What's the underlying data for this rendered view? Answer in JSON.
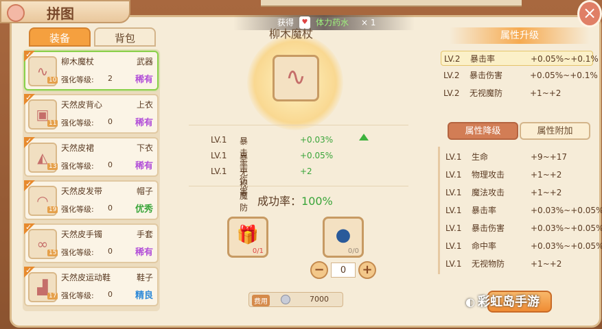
{
  "header": {
    "title": "拼图",
    "close": "×"
  },
  "notice": {
    "label": "获得",
    "potion_icon": "potion-icon",
    "item": "体力药水",
    "count": "× 1"
  },
  "tabs": {
    "equip": "装备",
    "bag": "背包"
  },
  "items": [
    {
      "name": "柳木魔杖",
      "slot": "武器",
      "enhance_label": "强化等级:",
      "enhance_value": "2",
      "rarity": "稀有",
      "rarity_color": "#b24fd8",
      "level": "10",
      "icon": "wand-icon",
      "selected": true
    },
    {
      "name": "天然皮背心",
      "slot": "上衣",
      "enhance_label": "强化等级:",
      "enhance_value": "0",
      "rarity": "稀有",
      "rarity_color": "#b24fd8",
      "level": "11",
      "icon": "vest-icon",
      "selected": false
    },
    {
      "name": "天然皮裙",
      "slot": "下衣",
      "enhance_label": "强化等级:",
      "enhance_value": "0",
      "rarity": "稀有",
      "rarity_color": "#b24fd8",
      "level": "13",
      "icon": "skirt-icon",
      "selected": false
    },
    {
      "name": "天然皮发带",
      "slot": "帽子",
      "enhance_label": "强化等级:",
      "enhance_value": "0",
      "rarity": "优秀",
      "rarity_color": "#3aa53a",
      "level": "19",
      "icon": "headband-icon",
      "selected": false
    },
    {
      "name": "天然皮手镯",
      "slot": "手套",
      "enhance_label": "强化等级:",
      "enhance_value": "0",
      "rarity": "稀有",
      "rarity_color": "#b24fd8",
      "level": "15",
      "icon": "bracelet-icon",
      "selected": false
    },
    {
      "name": "天然皮运动鞋",
      "slot": "鞋子",
      "enhance_label": "强化等级:",
      "enhance_value": "0",
      "rarity": "精良",
      "rarity_color": "#2f8ad8",
      "level": "17",
      "icon": "shoes-icon",
      "selected": false
    }
  ],
  "center": {
    "weapon_name": "柳木魔杖",
    "stats": [
      {
        "lv": "LV.1",
        "name": "暴击率",
        "value": "+0.03%"
      },
      {
        "lv": "LV.1",
        "name": "暴击伤害",
        "value": "+0.05%"
      },
      {
        "lv": "LV.1",
        "name": "无视魔防",
        "value": "+2"
      }
    ],
    "success_label": "成功率：",
    "success_value": "100%",
    "material1_count": "0/1",
    "material2_count": "0/0",
    "stepper_value": "0",
    "cost_label": "费用",
    "cost_value": "7000"
  },
  "right": {
    "upgrade_title": "属性升级",
    "upgrade": [
      {
        "lv": "LV.2",
        "name": "暴击率",
        "value": "+0.05%~+0.1%"
      },
      {
        "lv": "LV.2",
        "name": "暴击伤害",
        "value": "+0.05%~+0.1%"
      },
      {
        "lv": "LV.2",
        "name": "无视魔防",
        "value": "+1~+2"
      }
    ],
    "tab_downgrade": "属性降级",
    "tab_bonus": "属性附加",
    "bonus": [
      {
        "lv": "LV.1",
        "name": "生命",
        "value": "+9~+17"
      },
      {
        "lv": "LV.1",
        "name": "物理攻击",
        "value": "+1~+2"
      },
      {
        "lv": "LV.1",
        "name": "魔法攻击",
        "value": "+1~+2"
      },
      {
        "lv": "LV.1",
        "name": "暴击率",
        "value": "+0.03%~+0.05%"
      },
      {
        "lv": "LV.1",
        "name": "暴击伤害",
        "value": "+0.03%~+0.05%"
      },
      {
        "lv": "LV.1",
        "name": "命中率",
        "value": "+0.03%~+0.05%"
      },
      {
        "lv": "LV.1",
        "name": "无视物防",
        "value": "+1~+2"
      }
    ]
  },
  "watermark": "彩虹岛手游"
}
